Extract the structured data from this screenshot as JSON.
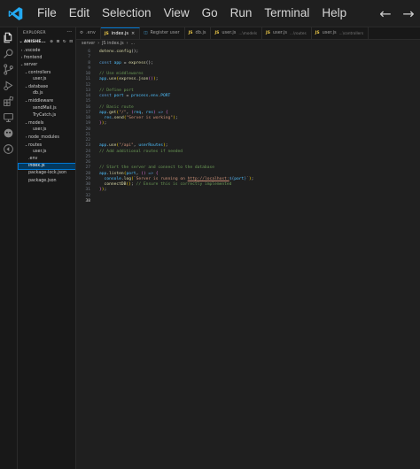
{
  "menu": [
    "File",
    "Edit",
    "Selection",
    "View",
    "Go",
    "Run",
    "Terminal",
    "Help"
  ],
  "nav": {
    "back": "←",
    "forward": "→"
  },
  "sidebar": {
    "title": "EXPLORER",
    "more": "···",
    "root": "ANISHE...",
    "tools": "⊕ ⊞ ↻ ⊟",
    "tree": [
      {
        "label": ".vscode",
        "indent": 1,
        "chev": "›"
      },
      {
        "label": "frontend",
        "indent": 1,
        "chev": "›"
      },
      {
        "label": "server",
        "indent": 1,
        "chev": "⌄"
      },
      {
        "label": "controllers",
        "indent": 2,
        "chev": "⌄"
      },
      {
        "label": "user.js",
        "indent": 3,
        "chev": ""
      },
      {
        "label": "database",
        "indent": 2,
        "chev": "⌄"
      },
      {
        "label": "db.js",
        "indent": 3,
        "chev": ""
      },
      {
        "label": "middleware",
        "indent": 2,
        "chev": "⌄"
      },
      {
        "label": "sendMail.js",
        "indent": 3,
        "chev": ""
      },
      {
        "label": "TryCatch.js",
        "indent": 3,
        "chev": ""
      },
      {
        "label": "models",
        "indent": 2,
        "chev": "⌄"
      },
      {
        "label": "user.js",
        "indent": 3,
        "chev": ""
      },
      {
        "label": "node_modules",
        "indent": 2,
        "chev": "›"
      },
      {
        "label": "routes",
        "indent": 2,
        "chev": "⌄"
      },
      {
        "label": "user.js",
        "indent": 3,
        "chev": ""
      },
      {
        "label": ".env",
        "indent": 2,
        "chev": ""
      },
      {
        "label": "index.js",
        "indent": 2,
        "chev": "",
        "selected": true
      },
      {
        "label": "package-lock.json",
        "indent": 2,
        "chev": ""
      },
      {
        "label": "package.json",
        "indent": 2,
        "chev": ""
      }
    ]
  },
  "tabs": [
    {
      "icon": "⚙",
      "iconClass": "gear",
      "label": ".env",
      "sub": "",
      "active": false
    },
    {
      "icon": "JS",
      "iconClass": "",
      "label": "index.js",
      "sub": "",
      "active": true
    },
    {
      "icon": "◫",
      "iconClass": "preview",
      "label": "Register user",
      "sub": "",
      "active": false
    },
    {
      "icon": "JS",
      "iconClass": "",
      "label": "db.js",
      "sub": "",
      "active": false
    },
    {
      "icon": "JS",
      "iconClass": "",
      "label": "user.js",
      "sub": "...\\models",
      "active": false
    },
    {
      "icon": "JS",
      "iconClass": "",
      "label": "user.js",
      "sub": "...\\routes",
      "active": false
    },
    {
      "icon": "JS",
      "iconClass": "",
      "label": "user.js",
      "sub": "...\\controllers",
      "active": false
    }
  ],
  "breadcrumb": [
    "server",
    "JS index.js",
    "..."
  ],
  "code": {
    "current_line": 38,
    "lines": [
      {
        "n": 6,
        "parts": [
          [
            "fn",
            "dotenv"
          ],
          [
            "pl",
            "."
          ],
          [
            "fn",
            "config"
          ],
          [
            "punc",
            "();"
          ]
        ]
      },
      {
        "n": 7,
        "parts": []
      },
      {
        "n": 8,
        "parts": [
          [
            "kw",
            "const "
          ],
          [
            "var",
            "app"
          ],
          [
            "pl",
            " = "
          ],
          [
            "fn",
            "express"
          ],
          [
            "punc",
            "();"
          ]
        ]
      },
      {
        "n": 9,
        "parts": []
      },
      {
        "n": 10,
        "parts": [
          [
            "cmt",
            "// Use middlewares"
          ]
        ]
      },
      {
        "n": 11,
        "parts": [
          [
            "var",
            "app"
          ],
          [
            "pl",
            "."
          ],
          [
            "fn",
            "use"
          ],
          [
            "brk",
            "("
          ],
          [
            "fn",
            "express"
          ],
          [
            "pl",
            "."
          ],
          [
            "fn",
            "json"
          ],
          [
            "brk2",
            "()"
          ],
          [
            "brk",
            ")"
          ],
          [
            "punc",
            ";"
          ]
        ]
      },
      {
        "n": 12,
        "parts": []
      },
      {
        "n": 13,
        "parts": [
          [
            "cmt",
            "// Define port"
          ]
        ]
      },
      {
        "n": 14,
        "parts": [
          [
            "kw",
            "const "
          ],
          [
            "var",
            "port"
          ],
          [
            "pl",
            " = "
          ],
          [
            "var",
            "process"
          ],
          [
            "pl",
            "."
          ],
          [
            "var",
            "env"
          ],
          [
            "pl",
            "."
          ],
          [
            "var",
            "PORT"
          ]
        ]
      },
      {
        "n": 15,
        "parts": []
      },
      {
        "n": 16,
        "parts": [
          [
            "cmt",
            "// Basic route"
          ]
        ]
      },
      {
        "n": 17,
        "parts": [
          [
            "var",
            "app"
          ],
          [
            "pl",
            "."
          ],
          [
            "fn",
            "get"
          ],
          [
            "brk",
            "("
          ],
          [
            "str",
            "\"/\""
          ],
          [
            "pl",
            ", "
          ],
          [
            "brk2",
            "("
          ],
          [
            "var",
            "req"
          ],
          [
            "pl",
            ", "
          ],
          [
            "var",
            "res"
          ],
          [
            "brk2",
            ")"
          ],
          [
            "kw",
            " => "
          ],
          [
            "brk2",
            "{"
          ]
        ]
      },
      {
        "n": 18,
        "parts": [
          [
            "pl",
            "  "
          ],
          [
            "var",
            "res"
          ],
          [
            "pl",
            "."
          ],
          [
            "fn",
            "send"
          ],
          [
            "brk",
            "("
          ],
          [
            "str",
            "\"Server is working\""
          ],
          [
            "brk",
            ")"
          ],
          [
            "punc",
            ";"
          ]
        ]
      },
      {
        "n": 19,
        "parts": [
          [
            "brk2",
            "}"
          ],
          [
            "brk",
            ")"
          ],
          [
            "punc",
            ";"
          ]
        ]
      },
      {
        "n": 20,
        "parts": []
      },
      {
        "n": 21,
        "parts": []
      },
      {
        "n": 22,
        "parts": []
      },
      {
        "n": 23,
        "parts": [
          [
            "var",
            "app"
          ],
          [
            "pl",
            "."
          ],
          [
            "fn",
            "use"
          ],
          [
            "brk",
            "("
          ],
          [
            "str",
            "\"/api\""
          ],
          [
            "pl",
            ", "
          ],
          [
            "var",
            "userRoutes"
          ],
          [
            "brk",
            ")"
          ],
          [
            "punc",
            ";"
          ]
        ]
      },
      {
        "n": 24,
        "parts": [
          [
            "cmt",
            "// Add additional routes if needed"
          ]
        ]
      },
      {
        "n": 25,
        "parts": []
      },
      {
        "n": 26,
        "parts": []
      },
      {
        "n": 27,
        "parts": [
          [
            "cmt",
            "// Start the server and connect to the database"
          ]
        ]
      },
      {
        "n": 28,
        "parts": [
          [
            "var",
            "app"
          ],
          [
            "pl",
            "."
          ],
          [
            "fn",
            "listen"
          ],
          [
            "brk",
            "("
          ],
          [
            "var",
            "port"
          ],
          [
            "pl",
            ", "
          ],
          [
            "brk2",
            "()"
          ],
          [
            "kw",
            " => "
          ],
          [
            "brk2",
            "{"
          ]
        ]
      },
      {
        "n": 29,
        "parts": [
          [
            "pl",
            "  "
          ],
          [
            "var",
            "console"
          ],
          [
            "pl",
            "."
          ],
          [
            "fn",
            "log"
          ],
          [
            "brk",
            "("
          ],
          [
            "str",
            "`Server is running on "
          ],
          [
            "link",
            "http://localhost:"
          ],
          [
            "tmpl",
            "${"
          ],
          [
            "var",
            "port"
          ],
          [
            "tmpl",
            "}"
          ],
          [
            "str",
            "`"
          ],
          [
            "brk",
            ")"
          ],
          [
            "punc",
            ";"
          ]
        ]
      },
      {
        "n": 30,
        "parts": [
          [
            "pl",
            "  "
          ],
          [
            "fn",
            "connectDB"
          ],
          [
            "brk",
            "()"
          ],
          [
            "punc",
            "; "
          ],
          [
            "cmt",
            "// Ensure this is correctly implemented"
          ]
        ]
      },
      {
        "n": 31,
        "parts": [
          [
            "brk2",
            "}"
          ],
          [
            "brk",
            ")"
          ],
          [
            "punc",
            ";"
          ]
        ]
      },
      {
        "n": 32,
        "parts": []
      },
      {
        "n": 38,
        "parts": []
      }
    ]
  },
  "colors": {
    "accent": "#0078d4",
    "logo": "#23a9f2"
  }
}
